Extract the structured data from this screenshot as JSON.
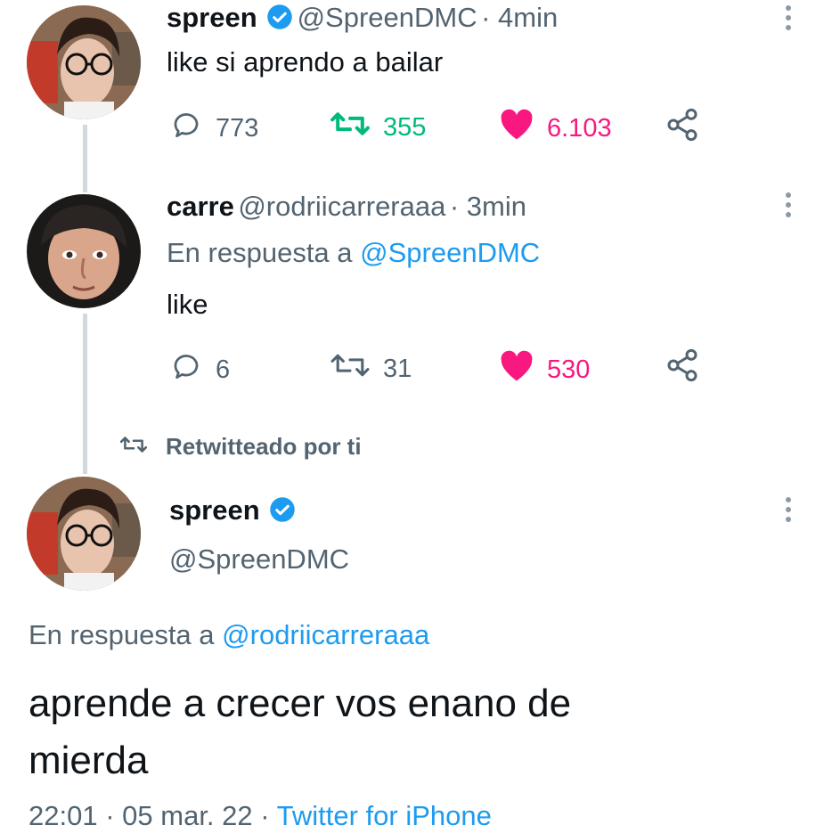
{
  "colors": {
    "text": "#0f1419",
    "secondary": "#536471",
    "link": "#1d9bf0",
    "retweet": "#00ba7c",
    "like": "#f91880",
    "line": "#cfd9de"
  },
  "tweet1": {
    "name": "spreen",
    "handle": "@SpreenDMC",
    "time": "· 4min",
    "text": "like si aprendo a bailar",
    "replies": "773",
    "retweets": "355",
    "likes": "6.103",
    "retweeted": true,
    "liked": true
  },
  "tweet2": {
    "name": "carre",
    "handle": "@rodriicarreraaa",
    "time": "· 3min",
    "reply_prefix": "En respuesta a",
    "reply_to": "@SpreenDMC",
    "text": "like",
    "replies": "6",
    "retweets": "31",
    "likes": "530",
    "retweeted": false,
    "liked": true
  },
  "retweet_banner": {
    "label": "Retwitteado por ti"
  },
  "tweet3": {
    "name": "spreen",
    "handle": "@SpreenDMC",
    "reply_prefix": "En respuesta a",
    "reply_to": "@rodriicarreraaa",
    "text_line1": "aprende a crecer vos enano de",
    "text_line2": "mierda",
    "time": "22:01",
    "date": "05 mar. 22",
    "source": "Twitter for iPhone"
  },
  "icons": [
    "verified-badge-icon",
    "reply-icon",
    "retweet-icon",
    "heart-icon",
    "share-icon",
    "more-icon"
  ]
}
